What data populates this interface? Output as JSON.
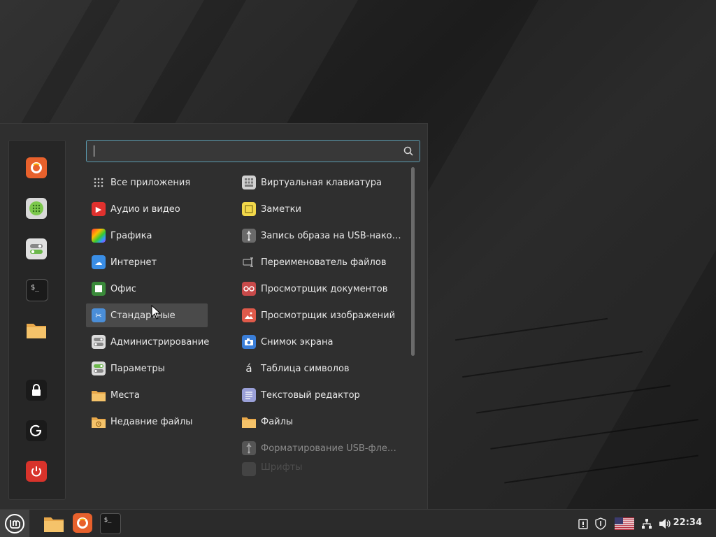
{
  "search": {
    "value": "",
    "placeholder": ""
  },
  "categories": [
    {
      "label": "Все приложения",
      "icon": "grid-icon"
    },
    {
      "label": "Аудио и видео",
      "icon": "play-icon"
    },
    {
      "label": "Графика",
      "icon": "graphics-icon"
    },
    {
      "label": "Интернет",
      "icon": "cloud-icon"
    },
    {
      "label": "Офис",
      "icon": "office-icon"
    },
    {
      "label": "Стандартные",
      "icon": "scissors-icon"
    },
    {
      "label": "Администрирование",
      "icon": "toggle-icon"
    },
    {
      "label": "Параметры",
      "icon": "settings-toggle-icon"
    },
    {
      "label": "Места",
      "icon": "folder-icon"
    },
    {
      "label": "Недавние файлы",
      "icon": "recent-folder-icon"
    }
  ],
  "apps": [
    {
      "label": "Виртуальная клавиатура",
      "icon": "keyboard-icon"
    },
    {
      "label": "Заметки",
      "icon": "note-icon"
    },
    {
      "label": "Запись образа на USB-нако…",
      "icon": "usb-icon"
    },
    {
      "label": "Переименователь файлов",
      "icon": "rename-icon"
    },
    {
      "label": "Просмотрщик документов",
      "icon": "glasses-icon"
    },
    {
      "label": "Просмотрщик изображений",
      "icon": "image-icon"
    },
    {
      "label": "Снимок экрана",
      "icon": "camera-icon"
    },
    {
      "label": "Таблица символов",
      "icon": "character-icon"
    },
    {
      "label": "Текстовый редактор",
      "icon": "text-editor-icon"
    },
    {
      "label": "Файлы",
      "icon": "folder-icon"
    },
    {
      "label": "Форматирование USB-фле…",
      "icon": "usb-icon"
    },
    {
      "label": "Шрифты",
      "icon": "font-icon"
    }
  ],
  "panel": {
    "clock": "22:34"
  },
  "colors": {
    "accent": "#5a9bb0",
    "menu_bg": "#2f2f2f",
    "panel_bg": "#2b2b2b"
  }
}
